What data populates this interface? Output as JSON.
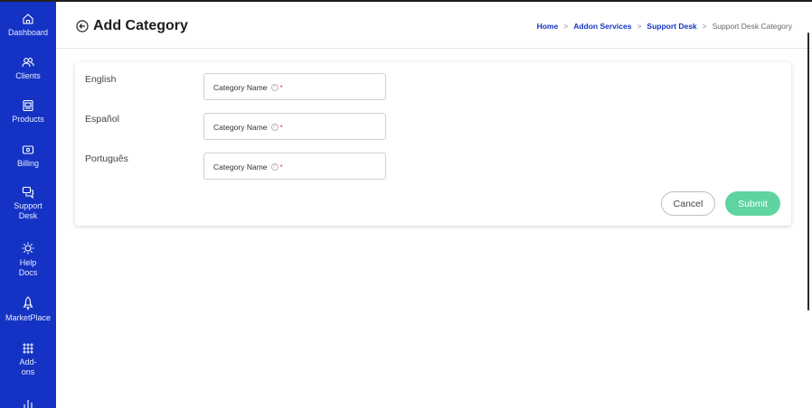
{
  "sidebar": {
    "items": [
      {
        "label": "Dashboard",
        "icon": "home-icon"
      },
      {
        "label": "Clients",
        "icon": "users-icon"
      },
      {
        "label": "Products",
        "icon": "products-icon"
      },
      {
        "label": "Billing",
        "icon": "billing-icon"
      },
      {
        "label": "Support Desk",
        "icon": "chat-icon"
      },
      {
        "label": "Help Docs",
        "icon": "gear-icon"
      },
      {
        "label": "MarketPlace",
        "icon": "rocket-icon"
      },
      {
        "label": "Add-ons",
        "icon": "grid-icon"
      }
    ]
  },
  "header": {
    "title": "Add Category",
    "breadcrumb": [
      "Home",
      "Addon Services",
      "Support Desk",
      "Support Desk Category"
    ],
    "separator": ">"
  },
  "form": {
    "rows": [
      {
        "language": "English",
        "placeholder": "Category Name",
        "required": "*"
      },
      {
        "language": "Español",
        "placeholder": "Category Name",
        "required": "*"
      },
      {
        "language": "Português",
        "placeholder": "Category Name",
        "required": "*"
      }
    ],
    "cancel_label": "Cancel",
    "submit_label": "Submit"
  },
  "colors": {
    "sidebar": "#1433c4",
    "accent": "#1433c4",
    "submit": "#5fd4a0",
    "required": "#e03b3b"
  }
}
